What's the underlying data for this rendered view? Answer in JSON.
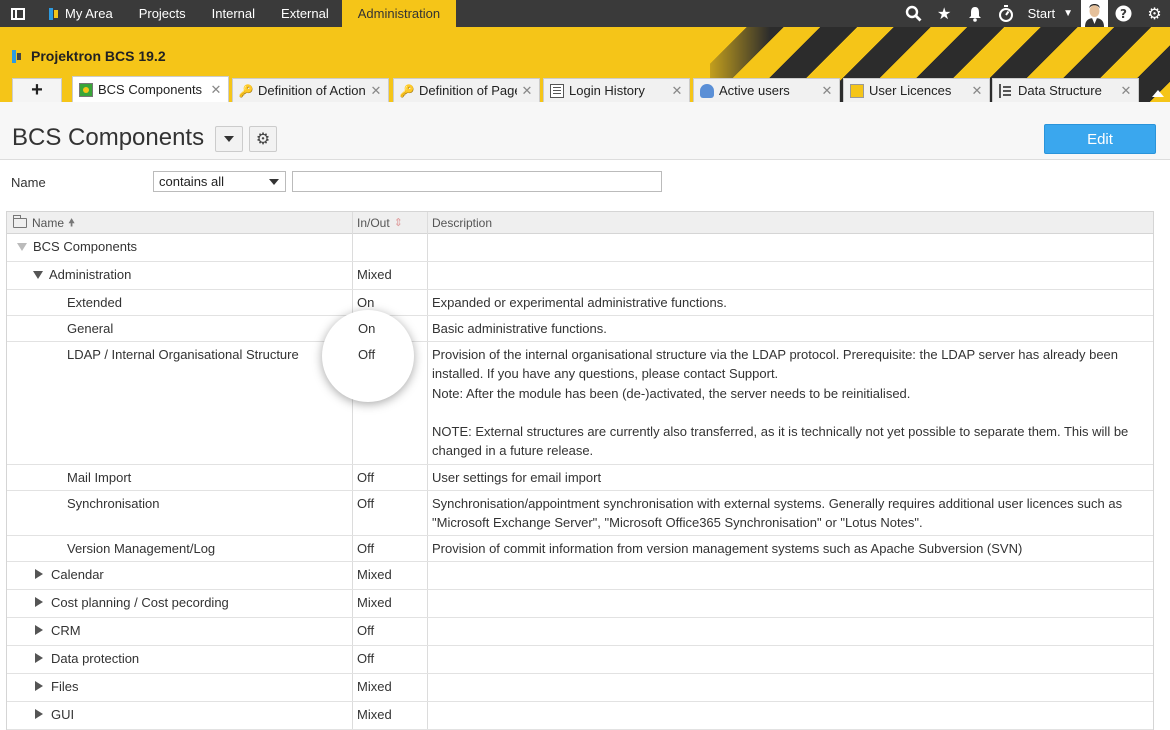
{
  "topnav": {
    "items": [
      "My Area",
      "Projects",
      "Internal",
      "External",
      "Administration"
    ],
    "active": "Administration",
    "start_label": "Start",
    "icons": [
      "search-icon",
      "star-icon",
      "bell-icon",
      "stopwatch-icon",
      "help-icon",
      "gear-icon"
    ]
  },
  "banner": {
    "product": "Projektron BCS 19.2",
    "accent": "#f5c518"
  },
  "tabs": [
    {
      "label": "BCS Components",
      "icon": "components-icon"
    },
    {
      "label": "Definition of Action F",
      "icon": "key-icon"
    },
    {
      "label": "Definition of Page D",
      "icon": "key-icon"
    },
    {
      "label": "Login History",
      "icon": "list-icon"
    },
    {
      "label": "Active users",
      "icon": "user-icon"
    },
    {
      "label": "User Licences",
      "icon": "licence-icon"
    },
    {
      "label": "Data Structure",
      "icon": "tree-icon"
    }
  ],
  "page": {
    "title": "BCS Components",
    "edit_label": "Edit",
    "edit_color": "#3aa7ee"
  },
  "filter": {
    "label": "Name",
    "operator": "contains all",
    "value": ""
  },
  "table": {
    "headers": {
      "name": "Name",
      "inout": "In/Out",
      "description": "Description"
    },
    "rows": [
      {
        "name": "BCS Components",
        "inout": "",
        "desc": ""
      },
      {
        "name": "Administration",
        "inout": "Mixed",
        "desc": ""
      },
      {
        "name": "Extended",
        "inout": "On",
        "desc": "Expanded or experimental administrative functions."
      },
      {
        "name": "General",
        "inout": "On",
        "desc": "Basic administrative functions."
      },
      {
        "name": "LDAP / Internal Organisational Structure",
        "inout": "Off",
        "desc": [
          "Provision of the internal organisational structure via the LDAP protocol. Prerequisite: the LDAP server has already been",
          "installed. If you have any questions, please contact Support.",
          "Note: After the module has been (de-)activated, the server needs to be reinitialised.",
          "",
          "NOTE: External structures are currently also transferred, as it is technically not yet possible to separate them. This will be",
          "changed in a future release."
        ]
      },
      {
        "name": "Mail Import",
        "inout": "Off",
        "desc": "User settings for email import"
      },
      {
        "name": "Synchronisation",
        "inout": "Off",
        "desc": [
          "Synchronisation/appointment synchronisation with external systems. Generally requires additional user licences such as",
          "\"Microsoft Exchange Server\", \"Microsoft Office365 Synchronisation\" or \"Lotus Notes\"."
        ]
      },
      {
        "name": "Version Management/Log",
        "inout": "Off",
        "desc": "Provision of commit information from version management systems such as Apache Subversion (SVN)"
      },
      {
        "name": "Calendar",
        "inout": "Mixed",
        "desc": ""
      },
      {
        "name": "Cost planning / Cost pecording",
        "inout": "Mixed",
        "desc": ""
      },
      {
        "name": "CRM",
        "inout": "Off",
        "desc": ""
      },
      {
        "name": "Data protection",
        "inout": "Off",
        "desc": ""
      },
      {
        "name": "Files",
        "inout": "Mixed",
        "desc": ""
      },
      {
        "name": "GUI",
        "inout": "Mixed",
        "desc": ""
      }
    ]
  },
  "magnifier": {
    "values": [
      "On",
      "Off"
    ]
  }
}
